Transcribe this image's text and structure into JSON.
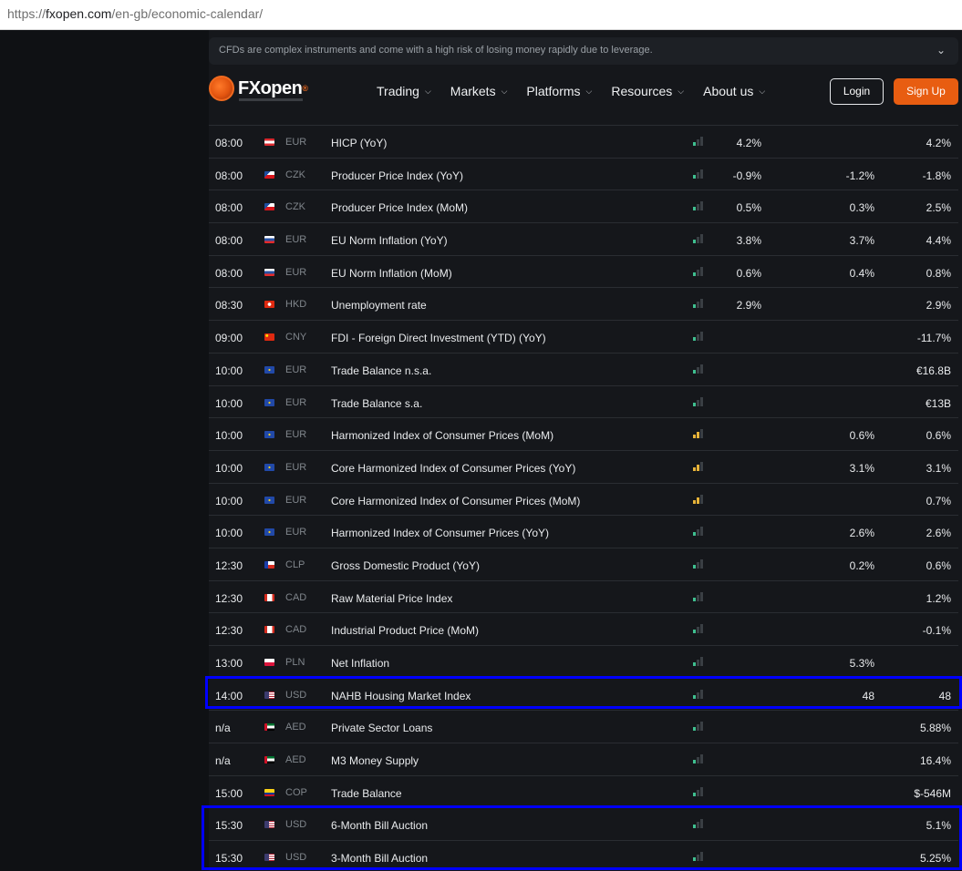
{
  "browser": {
    "url_prefix": "https://",
    "url_host": "fxopen.com",
    "url_path": "/en-gb/economic-calendar/"
  },
  "risk_warning": {
    "text": "CFDs are complex instruments and come with a high risk of losing money rapidly due to leverage.",
    "icon": "chevron-down-icon"
  },
  "header": {
    "logo": {
      "fx": "FX",
      "rest": "open",
      "reg": "®"
    },
    "menu": [
      "Trading",
      "Markets",
      "Platforms",
      "Resources",
      "About us"
    ],
    "login_label": "Login",
    "signup_label": "Sign Up",
    "colors": {
      "accent": "#e85d11"
    }
  },
  "rows": [
    {
      "time": "08:00",
      "currency": "EUR",
      "event": "HICP (YoY)",
      "impact": "low",
      "actual": "4.2%",
      "forecast": "",
      "previous": "4.2%",
      "flag": "at"
    },
    {
      "time": "08:00",
      "currency": "CZK",
      "event": "Producer Price Index (YoY)",
      "impact": "low",
      "actual": "-0.9%",
      "forecast": "-1.2%",
      "previous": "-1.8%",
      "flag": "cz"
    },
    {
      "time": "08:00",
      "currency": "CZK",
      "event": "Producer Price Index (MoM)",
      "impact": "low",
      "actual": "0.5%",
      "forecast": "0.3%",
      "previous": "2.5%",
      "flag": "cz"
    },
    {
      "time": "08:00",
      "currency": "EUR",
      "event": "EU Norm Inflation (YoY)",
      "impact": "low",
      "actual": "3.8%",
      "forecast": "3.7%",
      "previous": "4.4%",
      "flag": "sk"
    },
    {
      "time": "08:00",
      "currency": "EUR",
      "event": "EU Norm Inflation (MoM)",
      "impact": "low",
      "actual": "0.6%",
      "forecast": "0.4%",
      "previous": "0.8%",
      "flag": "sk"
    },
    {
      "time": "08:30",
      "currency": "HKD",
      "event": "Unemployment rate",
      "impact": "low",
      "actual": "2.9%",
      "forecast": "",
      "previous": "2.9%",
      "flag": "hk"
    },
    {
      "time": "09:00",
      "currency": "CNY",
      "event": "FDI - Foreign Direct Investment (YTD) (YoY)",
      "impact": "low",
      "actual": "",
      "forecast": "",
      "previous": "-11.7%",
      "flag": "cn"
    },
    {
      "time": "10:00",
      "currency": "EUR",
      "event": "Trade Balance n.s.a.",
      "impact": "low",
      "actual": "",
      "forecast": "",
      "previous": "€16.8B",
      "flag": "eu"
    },
    {
      "time": "10:00",
      "currency": "EUR",
      "event": "Trade Balance s.a.",
      "impact": "low",
      "actual": "",
      "forecast": "",
      "previous": "€13B",
      "flag": "eu"
    },
    {
      "time": "10:00",
      "currency": "EUR",
      "event": "Harmonized Index of Consumer Prices (MoM)",
      "impact": "med",
      "actual": "",
      "forecast": "0.6%",
      "previous": "0.6%",
      "flag": "eu"
    },
    {
      "time": "10:00",
      "currency": "EUR",
      "event": "Core Harmonized Index of Consumer Prices (YoY)",
      "impact": "med",
      "actual": "",
      "forecast": "3.1%",
      "previous": "3.1%",
      "flag": "eu"
    },
    {
      "time": "10:00",
      "currency": "EUR",
      "event": "Core Harmonized Index of Consumer Prices (MoM)",
      "impact": "med",
      "actual": "",
      "forecast": "",
      "previous": "0.7%",
      "flag": "eu"
    },
    {
      "time": "10:00",
      "currency": "EUR",
      "event": "Harmonized Index of Consumer Prices (YoY)",
      "impact": "low",
      "actual": "",
      "forecast": "2.6%",
      "previous": "2.6%",
      "flag": "eu"
    },
    {
      "time": "12:30",
      "currency": "CLP",
      "event": "Gross Domestic Product (YoY)",
      "impact": "low",
      "actual": "",
      "forecast": "0.2%",
      "previous": "0.6%",
      "flag": "cl"
    },
    {
      "time": "12:30",
      "currency": "CAD",
      "event": "Raw Material Price Index",
      "impact": "low",
      "actual": "",
      "forecast": "",
      "previous": "1.2%",
      "flag": "ca"
    },
    {
      "time": "12:30",
      "currency": "CAD",
      "event": "Industrial Product Price (MoM)",
      "impact": "low",
      "actual": "",
      "forecast": "",
      "previous": "-0.1%",
      "flag": "ca"
    },
    {
      "time": "13:00",
      "currency": "PLN",
      "event": "Net Inflation",
      "impact": "low",
      "actual": "",
      "forecast": "5.3%",
      "previous": "",
      "flag": "pl"
    },
    {
      "time": "14:00",
      "currency": "USD",
      "event": "NAHB Housing Market Index",
      "impact": "low",
      "actual": "",
      "forecast": "48",
      "previous": "48",
      "flag": "us"
    },
    {
      "time": "n/a",
      "currency": "AED",
      "event": "Private Sector Loans",
      "impact": "low",
      "actual": "",
      "forecast": "",
      "previous": "5.88%",
      "flag": "ae"
    },
    {
      "time": "n/a",
      "currency": "AED",
      "event": "M3 Money Supply",
      "impact": "low",
      "actual": "",
      "forecast": "",
      "previous": "16.4%",
      "flag": "ae"
    },
    {
      "time": "15:00",
      "currency": "COP",
      "event": "Trade Balance",
      "impact": "low",
      "actual": "",
      "forecast": "",
      "previous": "$-546M",
      "flag": "co"
    },
    {
      "time": "15:30",
      "currency": "USD",
      "event": "6-Month Bill Auction",
      "impact": "low",
      "actual": "",
      "forecast": "",
      "previous": "5.1%",
      "flag": "us"
    },
    {
      "time": "15:30",
      "currency": "USD",
      "event": "3-Month Bill Auction",
      "impact": "low",
      "actual": "",
      "forecast": "",
      "previous": "5.25%",
      "flag": "us"
    }
  ]
}
